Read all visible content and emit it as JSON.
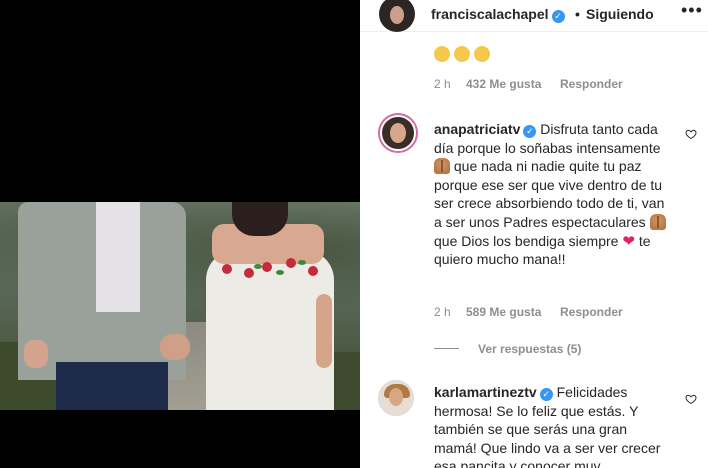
{
  "post": {
    "author": "franciscalachapel",
    "follow_status": "Siguiendo",
    "separator": "•",
    "more_icon": "more-horizontal-icon"
  },
  "comments": [
    {
      "time": "2 h",
      "likes": "432 Me gusta",
      "reply": "Responder"
    },
    {
      "username": "anapatriciatv",
      "text_1": "Disfruta tanto cada día porque lo soñabas intensamente",
      "text_2": "que nada ni nadie quite tu paz porque ese ser que vive dentro de tu ser crece absorbiendo todo de ti, van a ser unos Padres espectaculares",
      "text_3": "que Dios los bendiga siempre",
      "text_4": "te quiero mucho mana!!",
      "time": "2 h",
      "likes": "589 Me gusta",
      "reply": "Responder",
      "view_replies": "Ver respuestas (5)"
    },
    {
      "username": "karlamartineztv",
      "text": "Felicidades hermosa! Se lo feliz que estás. Y también se que serás una gran mamá! Que lindo va a ser ver crecer esa pancita y conocer muy"
    }
  ],
  "colors": {
    "verified": "#3897f0",
    "meta_text": "#8e8e8e",
    "primary_text": "#262626",
    "heart_red": "#e0245e"
  }
}
